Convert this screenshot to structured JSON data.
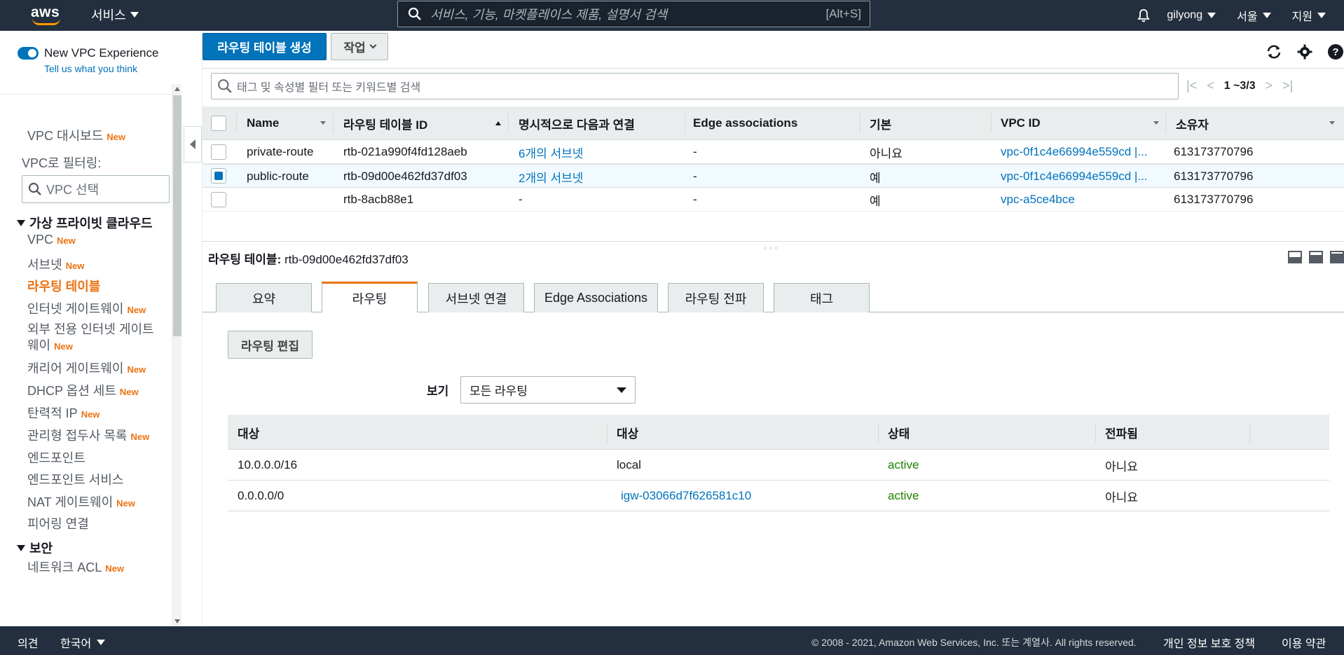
{
  "topnav": {
    "logo_text": "aws",
    "services_label": "서비스",
    "search_placeholder": "서비스, 기능, 마켓플레이스 제품, 설명서 검색",
    "search_shortcut": "[Alt+S]",
    "user": "gilyong",
    "region": "서울",
    "support": "지원"
  },
  "sidebar": {
    "toggle_label": "New VPC Experience",
    "feedback_link": "Tell us what you think",
    "dashboard": "VPC 대시보드",
    "new_badge": "New",
    "filter_label": "VPC로 필터링:",
    "filter_placeholder": "VPC 선택",
    "section_vpc": "가상 프라이빗 클라우드",
    "items": [
      {
        "label": "VPC",
        "new": true
      },
      {
        "label": "서브넷",
        "new": true
      },
      {
        "label": "라우팅 테이블",
        "new": false
      },
      {
        "label": "인터넷 게이트웨이",
        "new": true
      },
      {
        "label": "외부 전용 인터넷 게이트",
        "label2": "웨이",
        "new": true
      },
      {
        "label": "캐리어 게이트웨이",
        "new": true
      },
      {
        "label": "DHCP 옵션 세트",
        "new": true
      },
      {
        "label": "탄력적 IP",
        "new": true
      },
      {
        "label": "관리형 접두사 목록",
        "new": true
      },
      {
        "label": "엔드포인트",
        "new": false
      },
      {
        "label": "엔드포인트 서비스",
        "new": false
      },
      {
        "label": "NAT 게이트웨이",
        "new": true
      },
      {
        "label": "피어링 연결",
        "new": false
      }
    ],
    "section_security": "보안",
    "security_items": [
      {
        "label": "네트워크 ACL",
        "new": true
      }
    ]
  },
  "toolbar": {
    "create_label": "라우팅 테이블 생성",
    "actions_label": "작업"
  },
  "filter": {
    "placeholder": "태그 및 속성별 필터 또는 키워드별 검색"
  },
  "pager": {
    "range": "1 ~3/3"
  },
  "table": {
    "headers": [
      "Name",
      "라우팅 테이블 ID",
      "명시적으로 다음과 연결",
      "Edge associations",
      "기본",
      "VPC ID",
      "소유자"
    ],
    "rows": [
      {
        "name": "private-route",
        "id": "rtb-021a990f4fd128aeb",
        "explicit": "6개의 서브넷",
        "edge": "-",
        "main": "아니요",
        "vpc": "vpc-0f1c4e66994e559cd |...",
        "owner": "613173770796",
        "selected": false
      },
      {
        "name": "public-route",
        "id": "rtb-09d00e462fd37df03",
        "explicit": "2개의 서브넷",
        "edge": "-",
        "main": "예",
        "vpc": "vpc-0f1c4e66994e559cd |...",
        "owner": "613173770796",
        "selected": true
      },
      {
        "name": "",
        "id": "rtb-8acb88e1",
        "explicit": "-",
        "edge": "-",
        "main": "예",
        "vpc": "vpc-a5ce4bce",
        "owner": "613173770796",
        "selected": false
      }
    ]
  },
  "detail": {
    "title_label": "라우팅 테이블:",
    "title_value": "rtb-09d00e462fd37df03",
    "tabs": [
      "요약",
      "라우팅",
      "서브넷 연결",
      "Edge Associations",
      "라우팅 전파",
      "태그"
    ],
    "active_tab": "라우팅",
    "edit_button": "라우팅 편집",
    "view_label": "보기",
    "view_value": "모든 라우팅",
    "routes_headers": [
      "대상",
      "대상",
      "상태",
      "전파됨"
    ],
    "routes": [
      {
        "destination": "10.0.0.0/16",
        "target": "local",
        "status": "active",
        "propagated": "아니요"
      },
      {
        "destination": "0.0.0.0/0",
        "target": "igw-03066d7f626581c10",
        "status": "active",
        "propagated": "아니요"
      }
    ]
  },
  "footer": {
    "feedback": "의견",
    "language": "한국어",
    "copyright": "© 2008 - 2021, Amazon Web Services, Inc. 또는 계열사. All rights reserved.",
    "privacy": "개인 정보 보호 정책",
    "terms": "이용 약관"
  },
  "colors": {
    "nav_bg": "#232f3e",
    "primary": "#0073bb",
    "accent": "#ec7211",
    "status_active": "#1d8102"
  }
}
